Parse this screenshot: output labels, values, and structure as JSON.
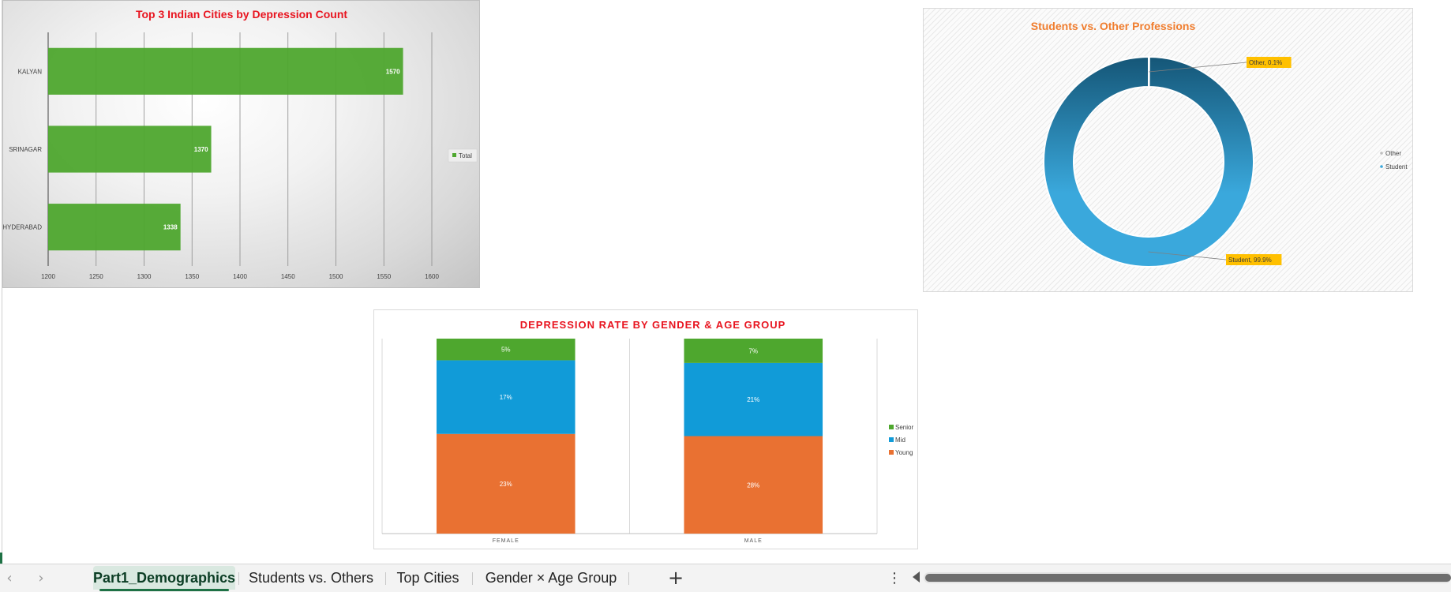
{
  "workbook": {
    "active_sheet": "Part1_Demographics",
    "tabs": [
      "Part1_Demographics",
      "Students vs. Others",
      "Top Cities",
      "Gender × Age Group"
    ],
    "add_sheet_symbol": "+",
    "more_symbol": "⋮",
    "nav_prev_symbol": "‹",
    "nav_next_symbol": "›"
  },
  "icons": {
    "nav_prev": "chevron-left-icon",
    "nav_next": "chevron-right-icon",
    "add_sheet": "plus-icon",
    "more": "more-vertical-icon",
    "scroll_left": "triangle-left-icon"
  },
  "chart_data": [
    {
      "type": "bar",
      "orientation": "horizontal",
      "title": "Top 3 Indian Cities by Depression Count",
      "categories": [
        "KALYAN",
        "SRINAGAR",
        "HYDERABAD"
      ],
      "series": [
        {
          "name": "Total",
          "values": [
            1570,
            1370,
            1338
          ],
          "color": "#4ea72e"
        }
      ],
      "data_labels": [
        "1570",
        "1370",
        "1338"
      ],
      "xlim": [
        1200,
        1600
      ],
      "x_ticks": [
        1200,
        1250,
        1300,
        1350,
        1400,
        1450,
        1500,
        1550,
        1600
      ],
      "grid": true,
      "legend": "right",
      "title_color": "#e8141f"
    },
    {
      "type": "pie",
      "variant": "donut",
      "title": "Students vs. Other Professions",
      "labels": [
        "Other",
        "Student"
      ],
      "values": [
        0.1,
        99.9
      ],
      "data_labels": [
        "Other, 0.1%",
        "Student, 99.9%"
      ],
      "colors": {
        "Other": "#d9d9d9",
        "Student": "#3aa8dc",
        "gradient_top": "#155677"
      },
      "legend": "right",
      "title_color": "#f07d2e",
      "callout_color": "#ffc000"
    },
    {
      "type": "bar",
      "variant": "stacked-100",
      "title": "DEPRESSION RATE BY GENDER & AGE GROUP",
      "categories": [
        "FEMALE",
        "MALE"
      ],
      "series": [
        {
          "name": "Young",
          "values": [
            23,
            28
          ],
          "color": "#e97132"
        },
        {
          "name": "Mid",
          "values": [
            17,
            21
          ],
          "color": "#119bd8"
        },
        {
          "name": "Senior",
          "values": [
            5,
            7
          ],
          "color": "#4ea72e"
        }
      ],
      "data_labels": {
        "Young": [
          "23%",
          "28%"
        ],
        "Mid": [
          "17%",
          "21%"
        ],
        "Senior": [
          "5%",
          "7%"
        ]
      },
      "legend": "right",
      "legend_order": [
        "Senior",
        "Mid",
        "Young"
      ],
      "grid": true,
      "title_color": "#e8141f"
    }
  ]
}
